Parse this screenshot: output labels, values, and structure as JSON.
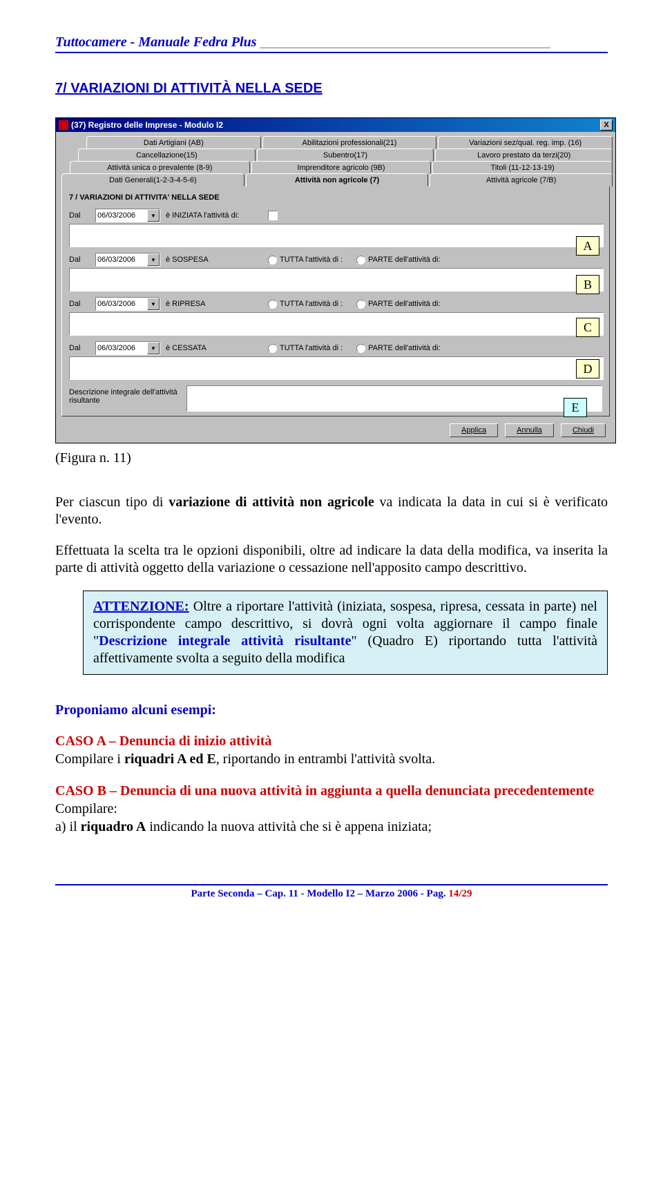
{
  "header": {
    "left": "Tuttocamere - Manuale Fedra Plus",
    "mid": "__"
  },
  "section_title": "7/ VARIAZIONI DI ATTIVITÀ NELLA SEDE",
  "window": {
    "title": "(37) Registro delle Imprese - Modulo I2",
    "close": "X",
    "tabs": {
      "r1": [
        "Dati Artigiani (AB)",
        "Abilitazioni professionali(21)",
        "Variazioni sez/qual. reg. imp. (16)"
      ],
      "r2": [
        "Cancellazione(15)",
        "Subentro(17)",
        "Lavoro prestato da terzi(20)"
      ],
      "r3": [
        "Attività unica o prevalente (8-9)",
        "Imprenditore agricolo (9B)",
        "Titoli (11-12-13-19)"
      ],
      "r4": [
        "Dati Generali(1-2-3-4-5-6)",
        "Attività non agricole (7)",
        "Attività agricole (7/B)"
      ]
    },
    "panel_title": "7 / VARIAZIONI DI ATTIVITA' NELLA SEDE",
    "dal": "Dal",
    "date": "06/03/2006",
    "iniziata": "è INIZIATA l'attività di:",
    "sospesa": "è SOSPESA",
    "ripresa": "è RIPRESA",
    "cessata": "è CESSATA",
    "tutta": "TUTTA l'attività di :",
    "parte": "PARTE dell'attività di:",
    "descr": "Descrizione integrale dell'attività risultante",
    "buttons": {
      "applica": "Applica",
      "annulla": "Annulla",
      "chiudi": "Chiudi"
    }
  },
  "callouts": {
    "a": "A",
    "b": "B",
    "c": "C",
    "d": "D",
    "e": "E"
  },
  "figure_caption": "(Figura n. 11)",
  "para1_a": "Per ciascun tipo di ",
  "para1_b": "variazione di attività non agricole",
  "para1_c": " va indicata la data in cui si è verificato l'evento.",
  "para2": "Effettuata la scelta tra le opzioni disponibili, oltre ad indicare la data della modifica, va inserita la parte di attività oggetto della variazione o cessazione nell'apposito campo descrittivo.",
  "attention": {
    "label": "ATTENZIONE:",
    "t1": " Oltre a riportare l'attività (iniziata, sospesa, ripresa, cessata in parte) nel corrispondente campo descrittivo, si dovrà ogni volta aggiornare il campo finale \"",
    "key": "Descrizione integrale attività risultante",
    "t2": "\" (Quadro E) riportando tutta l'attività affettivamente svolta a seguito della modifica"
  },
  "examples_head": "Proponiamo alcuni esempi:",
  "caseA": {
    "title": "CASO A – Denuncia di inizio attività",
    "l1a": "Compilare i ",
    "l1b": "riquadri A ed E",
    "l1c": ", riportando in entrambi l'attività svolta."
  },
  "caseB": {
    "title": "CASO B – Denuncia di una nuova attività in aggiunta a quella denunciata precedentemente",
    "l1": "Compilare:",
    "l2a": "a)  il ",
    "l2b": "riquadro A",
    "l2c": " indicando la nuova attività che si è appena iniziata;"
  },
  "footer": {
    "text": "Parte Seconda – Cap. 11 - Modello I2 – Marzo 2006 - Pag. ",
    "page": "14/29"
  }
}
